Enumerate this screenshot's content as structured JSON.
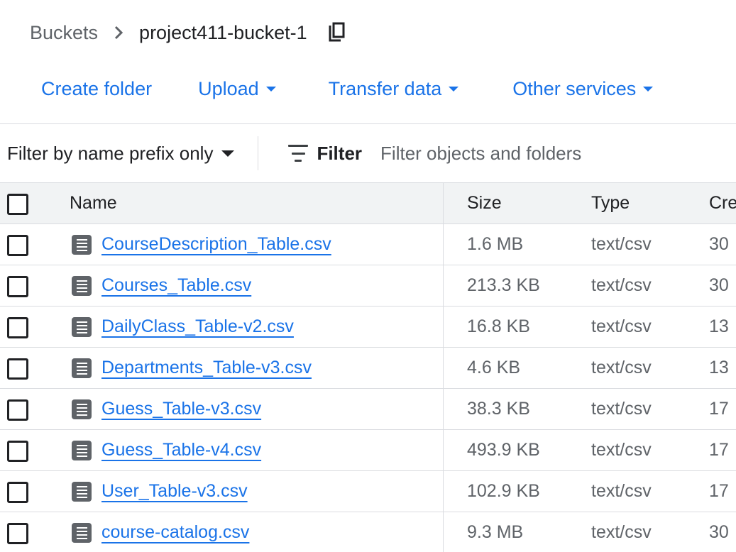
{
  "breadcrumb": {
    "root_label": "Buckets",
    "current": "project411-bucket-1"
  },
  "toolbar": {
    "create_folder": "Create folder",
    "upload": "Upload",
    "transfer_data": "Transfer data",
    "other_services": "Other services"
  },
  "filterbar": {
    "prefix_mode": "Filter by name prefix only",
    "filter_label": "Filter",
    "placeholder": "Filter objects and folders"
  },
  "table": {
    "headers": {
      "name": "Name",
      "size": "Size",
      "type": "Type",
      "created": "Cre"
    },
    "rows": [
      {
        "name": "CourseDescription_Table.csv",
        "size": "1.6 MB",
        "type": "text/csv",
        "created": "30"
      },
      {
        "name": "Courses_Table.csv",
        "size": "213.3 KB",
        "type": "text/csv",
        "created": "30"
      },
      {
        "name": "DailyClass_Table-v2.csv",
        "size": "16.8 KB",
        "type": "text/csv",
        "created": "13"
      },
      {
        "name": "Departments_Table-v3.csv",
        "size": "4.6 KB",
        "type": "text/csv",
        "created": "13"
      },
      {
        "name": "Guess_Table-v3.csv",
        "size": "38.3 KB",
        "type": "text/csv",
        "created": "17"
      },
      {
        "name": "Guess_Table-v4.csv",
        "size": "493.9 KB",
        "type": "text/csv",
        "created": "17"
      },
      {
        "name": "User_Table-v3.csv",
        "size": "102.9 KB",
        "type": "text/csv",
        "created": "17"
      },
      {
        "name": "course-catalog.csv",
        "size": "9.3 MB",
        "type": "text/csv",
        "created": "30"
      }
    ]
  },
  "colors": {
    "link": "#1a73e8",
    "header_bg": "#f1f3f4",
    "border": "#dadce0",
    "muted_text": "#5f6368"
  },
  "icons": {
    "breadcrumb_separator": "chevron-right-icon",
    "copy": "copy-icon",
    "dropdown": "caret-down-icon",
    "filter": "filter-list-icon",
    "file": "file-document-icon"
  }
}
